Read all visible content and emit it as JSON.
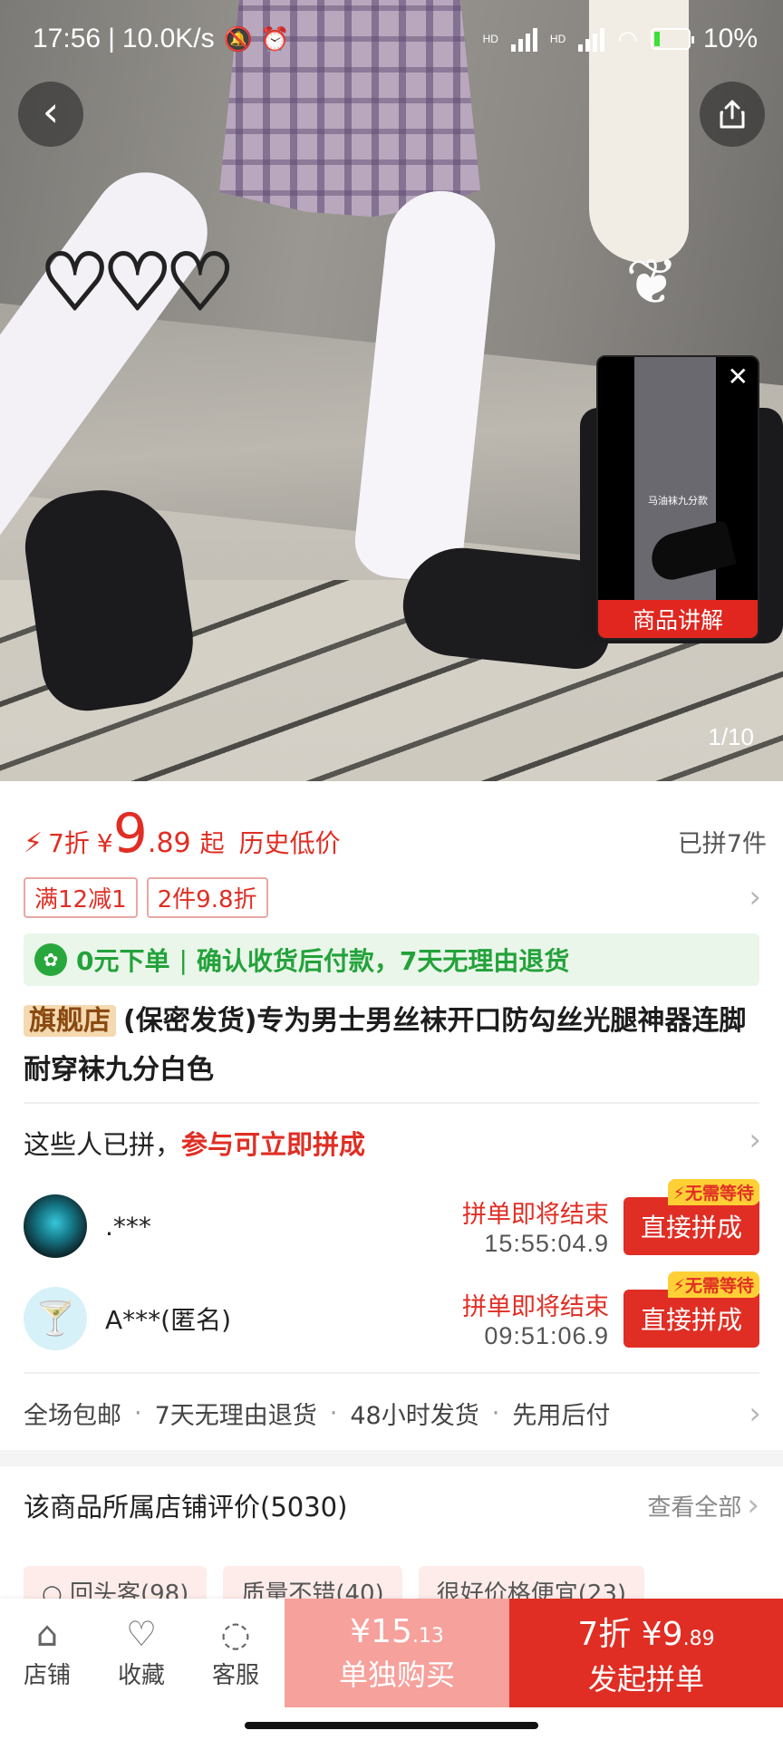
{
  "status_bar": {
    "time": "17:56",
    "net_speed": "10.0K/s",
    "network_1": "HD",
    "network_2": "HD",
    "battery": "10%"
  },
  "hero": {
    "counter": "1/10",
    "video_label": "商品讲解",
    "video_caption": "马油袜九分款"
  },
  "price": {
    "discount": "7折",
    "currency": "¥",
    "integer": "9",
    "decimal": ".89",
    "suffix": "起",
    "history": "历史低价",
    "sold": "已拼7件"
  },
  "promo_tags": [
    "满12减1",
    "2件9.8折"
  ],
  "assurance": {
    "left": "0元下单",
    "right": "确认收货后付款，7天无理由退货"
  },
  "product": {
    "store_tag": "旗舰店",
    "title": "(保密发货)专为男士男丝袜开口防勾丝光腿神器连脚耐穿袜九分白色"
  },
  "group": {
    "heading_prefix": "这些人已拼，",
    "heading_red": "参与可立即拼成",
    "rows": [
      {
        "name": ".***",
        "ending": "拼单即将结束",
        "countdown": "15:55:04.9",
        "button": "直接拼成",
        "badge": "无需等待"
      },
      {
        "name": "A***(匿名)",
        "ending": "拼单即将结束",
        "countdown": "09:51:06.9",
        "button": "直接拼成",
        "badge": "无需等待"
      }
    ]
  },
  "services": [
    "全场包邮",
    "7天无理由退货",
    "48小时发货",
    "先用后付"
  ],
  "reviews": {
    "title": "该商品所属店铺评价(5030)",
    "view_all": "查看全部",
    "tags": [
      "回头客(98)",
      "质量不错(40)",
      "很好价格便宜(23)"
    ]
  },
  "bottom_bar": {
    "nav": [
      {
        "label": "店铺",
        "icon": "store-icon"
      },
      {
        "label": "收藏",
        "icon": "heart-icon"
      },
      {
        "label": "客服",
        "icon": "chat-icon"
      }
    ],
    "buy_alone": {
      "price_int": "¥15",
      "price_dec": ".13",
      "label": "单独购买"
    },
    "buy_group": {
      "price_prefix": "7折 ¥9",
      "price_dec": ".89",
      "label": "发起拼单"
    }
  },
  "colors": {
    "accent_red": "#e02e24",
    "assurance_green": "#23a23a",
    "alone_pink": "#f6a19c"
  }
}
